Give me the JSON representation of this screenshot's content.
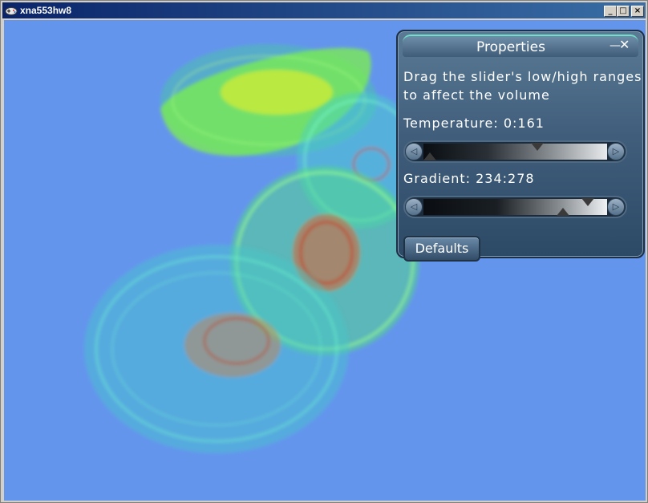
{
  "window": {
    "title": "xna553hw8",
    "minimize_glyph": "_",
    "maximize_glyph": "□",
    "close_glyph": "×"
  },
  "panel": {
    "title": "Properties",
    "minimize_glyph": "—",
    "close_glyph": "✕",
    "instructions_line1": "Drag the slider's low/high ranges",
    "instructions_line2": "to affect the volume",
    "temperature": {
      "label": "Temperature: 0:161",
      "low": 0,
      "high": 161,
      "min": 0,
      "max": 255
    },
    "gradient": {
      "label": "Gradient: 234:278",
      "low": 234,
      "high": 278,
      "min": 0,
      "max": 300
    },
    "defaults_label": "Defaults",
    "left_arrow_glyph": "◁",
    "right_arrow_glyph": "▷"
  },
  "colors": {
    "viewport_background": "#6495ed",
    "titlebar": "#0a246a",
    "panel": "#415f7c"
  }
}
